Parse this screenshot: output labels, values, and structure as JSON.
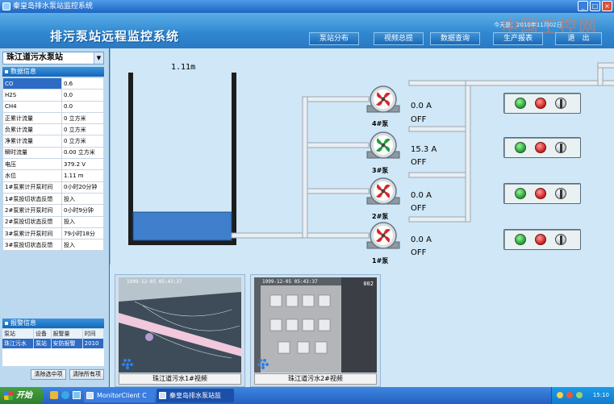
{
  "window": {
    "title": "秦皇岛排水泵站监控系统"
  },
  "header": {
    "app_title": "排污泵站远程监控系统",
    "datetime": "今天是：2010年11月02日",
    "watermark": "中国工控网",
    "nav": [
      {
        "label": "泵站分布"
      },
      {
        "label": "视频总揽"
      },
      {
        "label": "数据查询"
      },
      {
        "label": "生产报表"
      },
      {
        "label": "退　出"
      }
    ]
  },
  "sidebar": {
    "station": "珠江道污水泵站",
    "data_section_title": "数据信息",
    "data_rows": [
      {
        "key": "CO",
        "value": "0.6"
      },
      {
        "key": "H2S",
        "value": "0.0"
      },
      {
        "key": "CH4",
        "value": "0.0"
      },
      {
        "key": "正累计流量",
        "value": "0 立方米"
      },
      {
        "key": "负累计流量",
        "value": "0 立方米"
      },
      {
        "key": "净累计流量",
        "value": "0 立方米"
      },
      {
        "key": "瞬时流量",
        "value": "0.00 立方米"
      },
      {
        "key": "电压",
        "value": "379.2 V"
      },
      {
        "key": "水位",
        "value": "1.11 m"
      },
      {
        "key": "1#泵累计开泵时间",
        "value": "0小时20分钟"
      },
      {
        "key": "1#泵投切状态反馈",
        "value": "投入"
      },
      {
        "key": "2#泵累计开泵时间",
        "value": "0小时9分钟"
      },
      {
        "key": "2#泵投切状态反馈",
        "value": "投入"
      },
      {
        "key": "3#泵累计开泵时间",
        "value": "79小时18分"
      },
      {
        "key": "3#泵投切状态反馈",
        "value": "投入"
      }
    ],
    "alarm_section_title": "报警信息",
    "alarm_headers": [
      "泵站",
      "设备",
      "报警量",
      "时间"
    ],
    "alarm_rows": [
      [
        "珠江污水",
        "泵站",
        "安防报警",
        "2010"
      ]
    ],
    "btn_clear_selected": "清除选中项",
    "btn_clear_all": "清除所有项"
  },
  "schematic": {
    "water_level": "1.11m",
    "water_level_fraction": 0.28,
    "pumps": [
      {
        "name": "4#泵",
        "current": "0.0 A",
        "state": "OFF",
        "running": false
      },
      {
        "name": "3#泵",
        "current": "15.3 A",
        "state": "OFF",
        "running": true
      },
      {
        "name": "2#泵",
        "current": "0.0 A",
        "state": "OFF",
        "running": false
      },
      {
        "name": "1#泵",
        "current": "0.0 A",
        "state": "OFF",
        "running": false
      }
    ],
    "colors": {
      "pump_running": "#1f9c3a",
      "pump_stopped": "#d62828",
      "water": "#3f7fcc"
    }
  },
  "videos": [
    {
      "caption": "珠江道污水1#视频",
      "timestamp": "1999-12-05 05:43:37",
      "cam": ""
    },
    {
      "caption": "珠江道污水2#视频",
      "timestamp": "1999-12-05 05:43:37",
      "cam": "002"
    }
  ],
  "taskbar": {
    "start": "开始",
    "items": [
      {
        "label": "MonitorClient C"
      },
      {
        "label": "秦皇岛排水泵站监"
      }
    ],
    "clock": "15:10"
  }
}
